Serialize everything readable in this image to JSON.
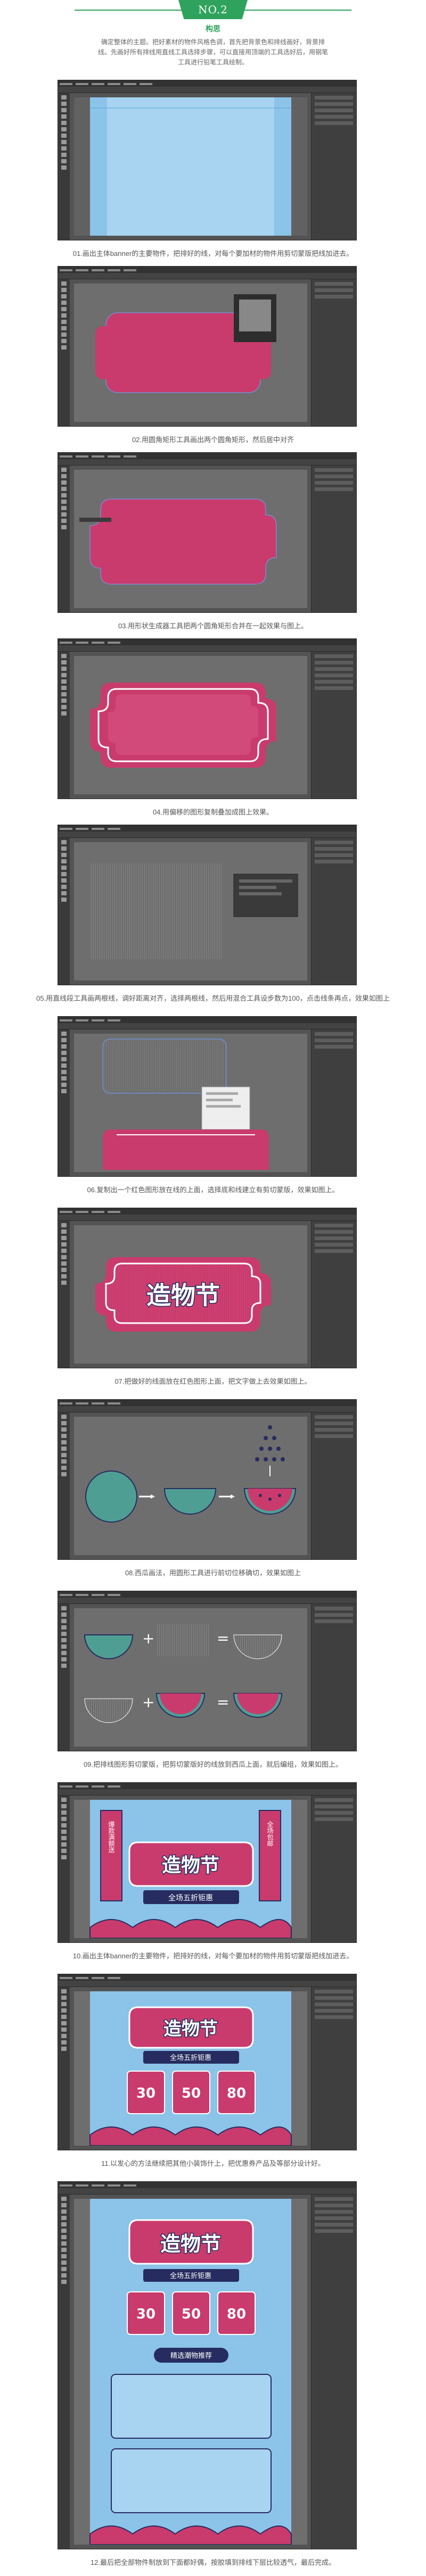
{
  "header": {
    "badge": "NO.2",
    "subtitle": "构思",
    "intro": "确定整体的主题。把好素材的物件风格色调，首先把背景色和排线画好，背景排线。先画好所有排线用直线工具选择步骤，可以直接用顶端的工具选好后，用钢笔工具进行铅笔工具绘制。"
  },
  "steps": [
    {
      "caption": "01.画出主体banner的主要物件，把排好的线，对每个要加材的物件用剪切蒙版把线加进去。"
    },
    {
      "caption": "02.用圆角矩形工具画出两个圆角矩形，然后居中对齐"
    },
    {
      "caption": "03.用形状生成器工具把两个圆角矩形合并在一起效果与图上。"
    },
    {
      "caption": "04.用偏移的图形复制叠加成图上效果。"
    },
    {
      "caption": "05.用直线段工具画两根线，调好距离对齐，选择两根线，然后用混合工具设步数为100，点击线条再点，效果如图上"
    },
    {
      "caption": "06.复制出一个红色图形放在线的上面，选择底和线建立有剪切蒙版，效果如图上。"
    },
    {
      "caption": "07.把做好的线面放在红色图形上面，把文字做上去效果如图上。"
    },
    {
      "caption": "08.西瓜画法，用圆形工具进行前切位移确切，效果如图上"
    },
    {
      "caption": "09.把排线图形剪切蒙版，把剪切蒙版好的线放到西瓜上面，就后编组，效果如图上。"
    },
    {
      "caption": "10.画出主体banner的主要物件，把排好的线，对每个要加材的物件用剪切蒙版把线加进去。"
    },
    {
      "caption": "11.以发心的方法继续把其他小装饰什上，把优惠券产品及等部分设计好。"
    },
    {
      "caption": "12.最后把全部物件制放到下面都好偶，按胶填到排线下层比较透气，最后完成。"
    }
  ],
  "art": {
    "title_text": "造物节",
    "banner_sub": "全场五折钜惠",
    "banner_left": "爆款满额送",
    "banner_right": "全场包邮",
    "coupon_1": "30",
    "coupon_2": "50",
    "coupon_3": "80",
    "bottom_btn": "精选潮物推荐"
  },
  "colors": {
    "accent": "#2fa35d",
    "pink": "#c93b6c",
    "navy": "#262c5f",
    "sky": "#8cc3e8",
    "teal": "#4f9e94"
  }
}
